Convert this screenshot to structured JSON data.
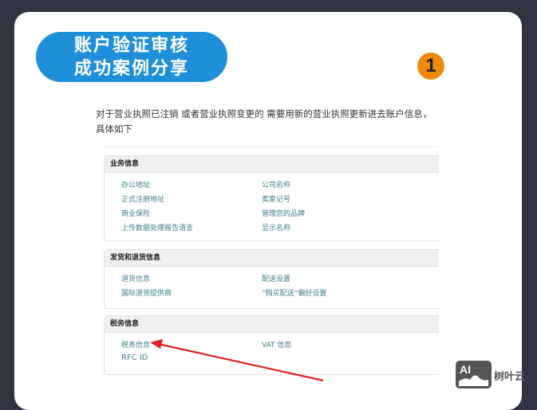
{
  "title_lines": [
    "账户验证审核",
    "成功案例分享"
  ],
  "step_number": "1",
  "intro": "对于营业执照已注销  或者营业执照变更的    需要用新的营业执照更新进去账户信息，具体如下",
  "sections": [
    {
      "title": "业务信息",
      "links": [
        "办公地址",
        "公司名称",
        "正式注册地址",
        "卖家记号",
        "商业保险",
        "管理您的品牌",
        "上传数据处理报告语言",
        "显示名称"
      ]
    },
    {
      "title": "发货和退货信息",
      "links": [
        "退货信息",
        "配送设置",
        "国际退货提供商",
        "“购买配送”偏好设置"
      ]
    },
    {
      "title": "税务信息",
      "links": [
        "税务信息",
        "VAT 信息",
        "RFC ID"
      ]
    }
  ],
  "watermark": {
    "logo": "AI",
    "text": "树叶云"
  },
  "colors": {
    "pill": "#1e8fd8",
    "badge": "#f08a0c",
    "arrow": "#d9231c",
    "link": "#3c7f8a"
  }
}
